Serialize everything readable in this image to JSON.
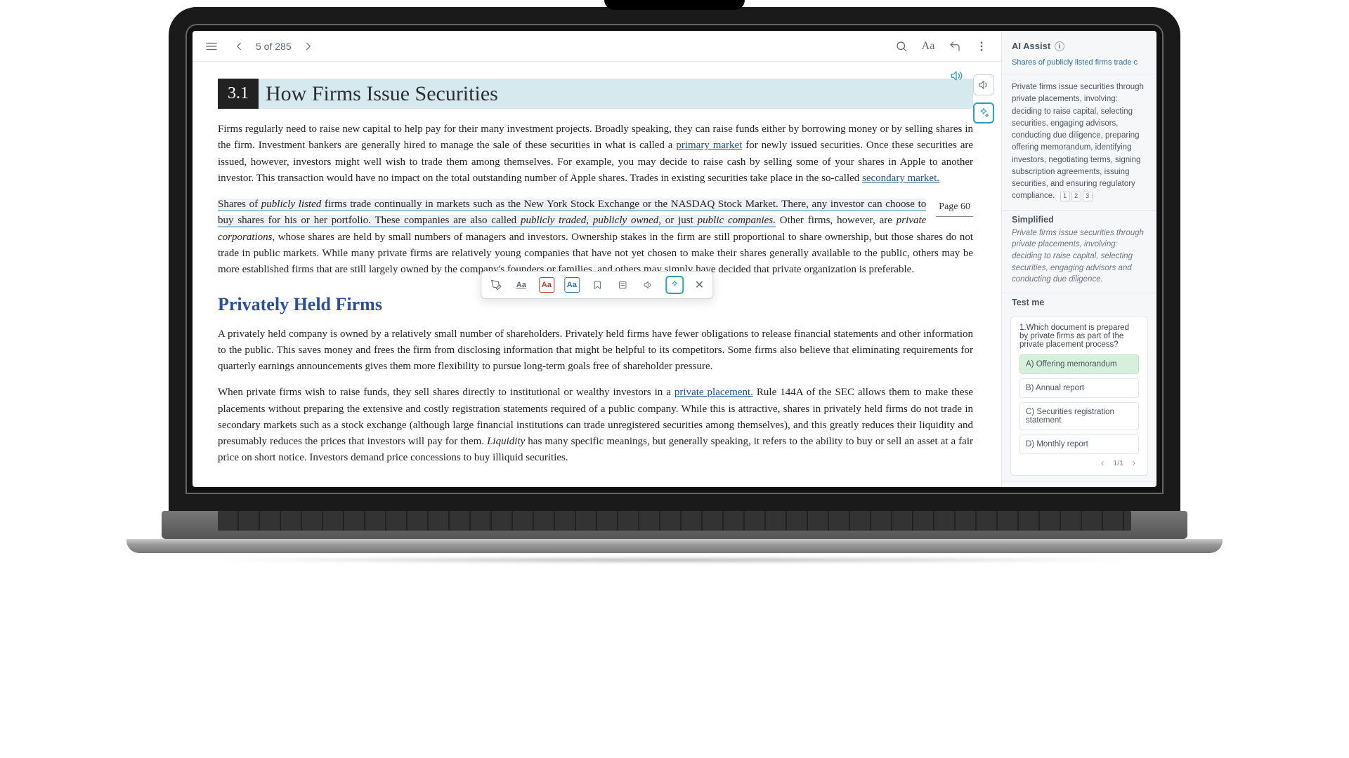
{
  "toolbar": {
    "page_label": "5 of 285"
  },
  "content": {
    "chapter_number": "3.1",
    "chapter_title": "How Firms Issue Securities",
    "p1_a": "Firms regularly need to raise new capital to help pay for their many investment projects. Broadly speaking, they can raise funds either by borrowing money or by selling shares in the firm. Investment bankers are generally hired to manage the sale of these securities in what is called a ",
    "p1_link1": "primary market",
    "p1_b": " for newly issued securities. Once these securities are issued, however, investors might well wish to trade them among themselves. For example, you may decide to raise cash by selling some of your shares in Apple to another investor. This transaction would have no impact on the total outstanding number of Apple shares. Trades in existing securities take place in the so-called ",
    "p1_link2": "secondary market.",
    "page_float": "Page 60",
    "p2_a": "Shares of ",
    "p2_em1": "publicly listed",
    "p2_b": " firms trade continually in markets such as the New York Stock Exchange or the NASDAQ Stock Market. There, any investor can choose to buy shares for his or her portfolio. These companies are also called ",
    "p2_em2": "publicly traded, publicly owned,",
    "p2_c": " or just ",
    "p2_em3": "public companies.",
    "p2_d": " Other firms, however, are ",
    "p2_em4": "private corporations,",
    "p2_e": " whose shares are held by small numbers of managers and investors. Ownership stakes in the firm are still proportional to share ownership, but those shares do not trade in public markets. While many private firms are relatively young companies that have not yet chosen to make their shares generally available to the public, others may be more established firms that are still largely owned by the company's founders or families, and others may simply have decided that private organization is preferable.",
    "section_title": "Privately Held Firms",
    "p3": "A privately held company is owned by a relatively small number of shareholders. Privately held firms have fewer obligations to release financial statements and other information to the public. This saves money and frees the firm from disclosing information that might be helpful to its competitors. Some firms also believe that eliminating requirements for quarterly earnings announcements gives them more flexibility to pursue long-term goals free of shareholder pressure.",
    "p4_a": "When private firms wish to raise funds, they sell shares directly to institutional or wealthy investors in a ",
    "p4_link": "private placement.",
    "p4_b": " Rule 144A of the SEC allows them to make these placements without preparing the extensive and costly registration statements required of a public company. While this is attractive, shares in privately held firms do not trade in secondary markets such as a stock exchange (although large financial institutions can trade unregistered securities among themselves), and this greatly reduces their liquidity and presumably reduces the prices that investors will pay for them. ",
    "p4_em": "Liquidity",
    "p4_c": " has many specific meanings, but generally speaking, it refers to the ability to buy or sell an asset at a fair price on short notice. Investors demand price concessions to buy illiquid securities."
  },
  "sel_toolbar": {
    "aa": "Aa"
  },
  "sidebar": {
    "title": "AI Assist",
    "link": "Shares of publicly listed firms trade c",
    "summary": "Private firms issue securities through private placements, involving: deciding to raise capital, selecting securities, engaging advisors, conducting due diligence, preparing offering memorandum, identifying investors, negotiating terms, signing subscription agreements, issuing securities, and ensuring regulatory compliance.",
    "chips": [
      "1",
      "2",
      "3"
    ],
    "simplified_head": "Simplified",
    "simplified_body": "Private firms issue securities through private placements, involving: deciding to raise capital, selecting securities, engaging advisors and conducting due diligence.",
    "testme_head": "Test me",
    "quiz": {
      "question": "1.Which document is prepared by private firms as part of the private placement process?",
      "options": [
        "A) Offering memorandum",
        "B) Annual report",
        "C) Securities registration statement",
        "D) Monthly report"
      ],
      "pager": "1/1"
    }
  }
}
